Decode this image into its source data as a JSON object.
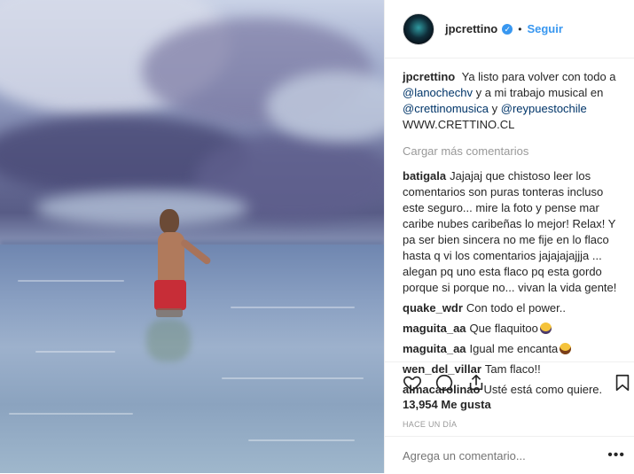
{
  "post": {
    "username": "jpcrettino",
    "follow_label": "Seguir",
    "dot": "•",
    "verified_glyph": "✓"
  },
  "caption": {
    "user": "jpcrettino",
    "text_1": "Ya listo para volver con todo a",
    "mention_1": "@lanochechv",
    "text_2": "y a mi trabajo musical en",
    "mention_2": "@crettinomusica",
    "text_3": "y",
    "mention_3": "@reypuestochile",
    "link": "WWW.CRETTINO.CL"
  },
  "load_more": "Cargar más comentarios",
  "comments": [
    {
      "user": "batigala",
      "text": "Jajajaj que chistoso leer los comentarios son puras tonteras incluso este seguro... mire la foto y pense mar caribe nubes caribeñas lo mejor! Relax! Y pa ser bien sincera no me fije en lo flaco hasta q vi los comentarios jajajajajjja ... alegan pq uno esta flaco pq esta gordo porque si porque no... vivan la vida gente!"
    },
    {
      "user": "quake_wdr",
      "text": "Con todo el power.."
    },
    {
      "user": "maguita_aa",
      "text": "Que flaquitoo"
    },
    {
      "user": "maguita_aa",
      "text": "Igual me encanta"
    },
    {
      "user": "wen_del_villar",
      "text": "Tam flaco!!"
    },
    {
      "user": "almacarolinao",
      "text": "Usté está como quiere."
    }
  ],
  "likes": "13,954 Me gusta",
  "timestamp": "HACE UN DÍA",
  "add_comment": {
    "placeholder": "Agrega un comentario..."
  },
  "more_glyph": "•••",
  "colors": {
    "link": "#3897f0",
    "mention": "#003569",
    "muted": "#999999",
    "shorts": "#c72d37"
  },
  "icons": [
    "heart-icon",
    "comment-icon",
    "share-icon",
    "bookmark-icon",
    "verified-badge-icon",
    "more-options-icon"
  ]
}
